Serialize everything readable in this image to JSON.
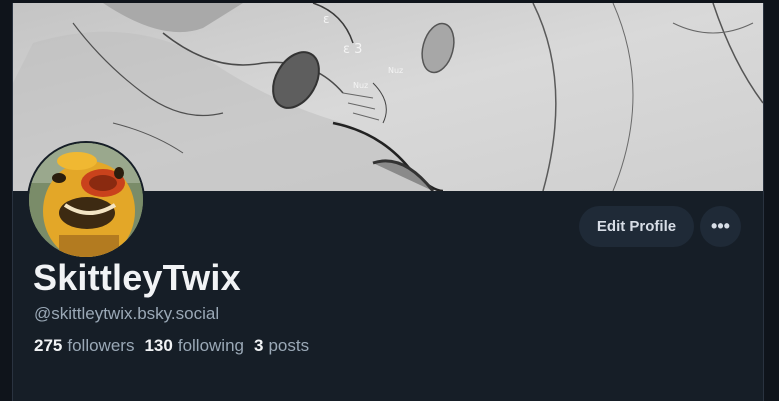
{
  "profile": {
    "display_name": "SkittleyTwix",
    "handle": "@skittleytwix.bsky.social",
    "followers_count": "275",
    "followers_label": "followers",
    "following_count": "130",
    "following_label": "following",
    "posts_count": "3",
    "posts_label": "posts"
  },
  "actions": {
    "edit_profile_label": "Edit Profile",
    "more_label": "•••"
  },
  "icons": {
    "more": "more-horizontal-icon"
  },
  "colors": {
    "page_background": "#161e27",
    "button_background": "#1f2a37",
    "text_primary": "#f1f3f5",
    "text_secondary": "#9aa8b6"
  }
}
